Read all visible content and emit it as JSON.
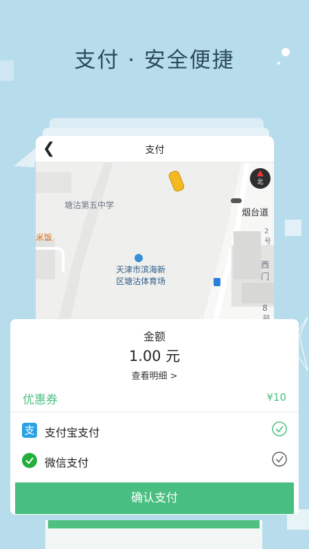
{
  "banner": {
    "title": "支付 · 安全便捷"
  },
  "screen": {
    "back_icon": "chevron-left-icon",
    "title": "支付",
    "map": {
      "labels": {
        "school": "塘沽第五中学",
        "stadium": "天津市滨海新\n区塘沽体育场",
        "road": "烟台道",
        "shop": "米饭",
        "west_gate": "西门",
        "num_2": "2号",
        "num_8": "8号",
        "compass": "北"
      }
    }
  },
  "payment": {
    "amount_label": "金额",
    "amount_value": "1.00 元",
    "detail_link": "查看明细  >",
    "coupon_label": "优惠券",
    "coupon_value": "¥10",
    "methods": [
      {
        "label": "支付宝支付",
        "icon": "alipay-icon",
        "selected": true,
        "color": "#2ba1e6"
      },
      {
        "label": "微信支付",
        "icon": "wechat-icon",
        "selected": false,
        "color": "#22b03a"
      }
    ],
    "confirm_label": "确认支付"
  },
  "colors": {
    "accent": "#48bf80",
    "background": "#b7dcec"
  }
}
